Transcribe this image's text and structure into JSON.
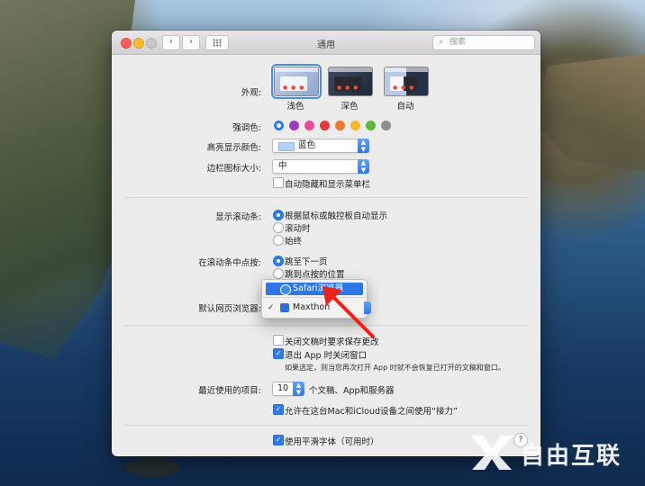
{
  "window": {
    "title": "通用",
    "search_placeholder": "搜索",
    "nav_back": "‹",
    "nav_forward": "›"
  },
  "appearance": {
    "label": "外观:",
    "options": [
      {
        "name": "浅色",
        "selected": true
      },
      {
        "name": "深色",
        "selected": false
      },
      {
        "name": "自动",
        "selected": false
      }
    ]
  },
  "accent": {
    "label": "强调色:",
    "colors": [
      "#2f7be8",
      "#9b3fb8",
      "#e8489a",
      "#e23b3b",
      "#f0782e",
      "#f2b72b",
      "#5cb83a",
      "#8e8e8e"
    ],
    "selected_index": 0
  },
  "highlight": {
    "label": "高亮显示颜色:",
    "value": "蓝色",
    "swatch_color": "#b3d1f7"
  },
  "sidebar_icon": {
    "label": "边栏图标大小:",
    "value": "中"
  },
  "auto_hide_menu": {
    "label": "自动隐藏和显示菜单栏",
    "checked": false
  },
  "scrollbars": {
    "label": "显示滚动条:",
    "options": [
      {
        "label": "根据鼠标或触控板自动显示",
        "selected": true
      },
      {
        "label": "滚动时",
        "selected": false
      },
      {
        "label": "始终",
        "selected": false
      }
    ]
  },
  "click_scrollbar": {
    "label": "在滚动条中点按:",
    "options": [
      {
        "label": "跳至下一页",
        "selected": true
      },
      {
        "label": "跳到点按的位置",
        "selected": false
      }
    ]
  },
  "default_browser": {
    "label": "默认网页浏览器:",
    "menu": [
      {
        "label": "Safari浏览器",
        "highlighted": true,
        "checked": false,
        "icon": "safari-icon",
        "icon_color": "#3a8ee8"
      },
      {
        "label": "Maxthon",
        "highlighted": false,
        "checked": true,
        "icon": "maxthon-icon",
        "icon_color": "#2f6fd8"
      }
    ],
    "check_mark": "✓"
  },
  "close_docs": {
    "label": "关闭文稿时要求保存更改",
    "checked": false
  },
  "close_windows": {
    "label": "退出 App 时关闭窗口",
    "checked": true,
    "note": "如果选定，则当您再次打开 App 时就不会恢复已打开的文稿和窗口。"
  },
  "recent_items": {
    "label": "最近使用的项目:",
    "value": "10",
    "suffix": "个文稿、App和服务器"
  },
  "handoff": {
    "label": "允许在这台Mac和iCloud设备之间使用“接力”",
    "checked": true
  },
  "font_smoothing": {
    "label": "使用平滑字体（可用时）",
    "checked": true
  },
  "help_label": "?",
  "watermark": {
    "text": "自由互联"
  }
}
